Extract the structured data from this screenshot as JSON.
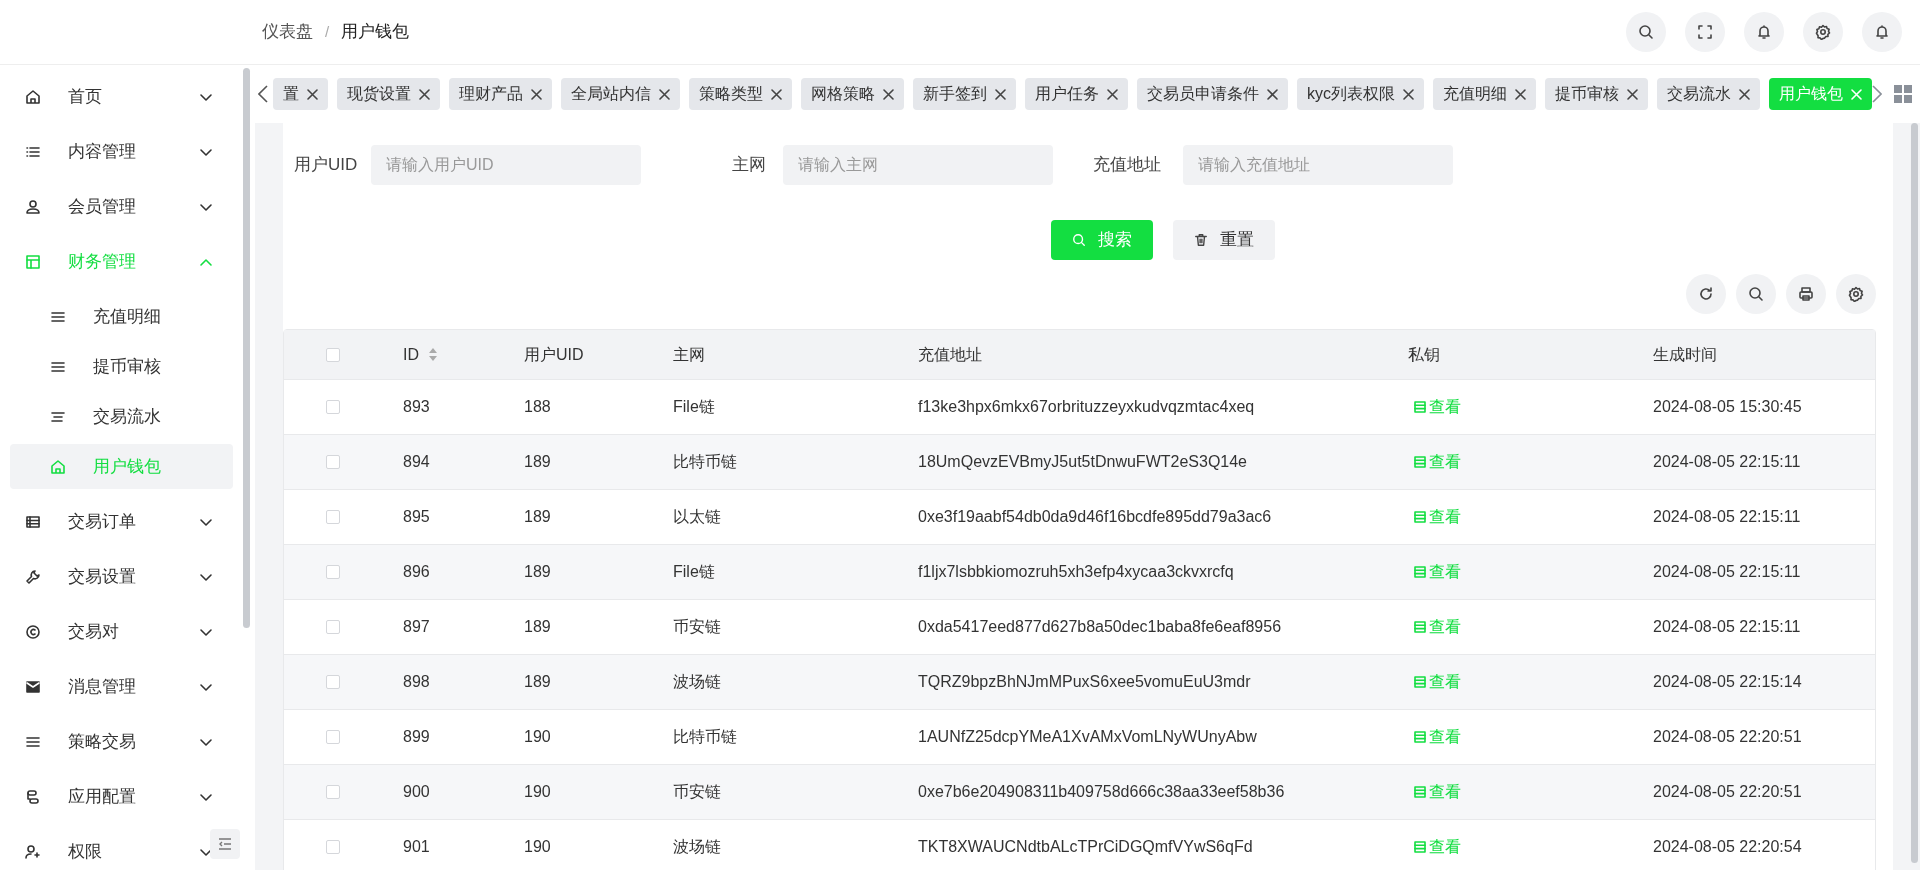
{
  "breadcrumb": [
    "仪表盘",
    "用户钱包"
  ],
  "breadcrumb_separator": "/",
  "sidebar": {
    "items": [
      {
        "label": "首页",
        "expanded": false
      },
      {
        "label": "内容管理",
        "expanded": false
      },
      {
        "label": "会员管理",
        "expanded": false
      },
      {
        "label": "财务管理",
        "expanded": true,
        "children": [
          {
            "label": "充值明细",
            "selected": false
          },
          {
            "label": "提币审核",
            "selected": false
          },
          {
            "label": "交易流水",
            "selected": false
          },
          {
            "label": "用户钱包",
            "selected": true
          }
        ]
      },
      {
        "label": "交易订单",
        "expanded": false
      },
      {
        "label": "交易设置",
        "expanded": false
      },
      {
        "label": "交易对",
        "expanded": false
      },
      {
        "label": "消息管理",
        "expanded": false
      },
      {
        "label": "策略交易",
        "expanded": false
      },
      {
        "label": "应用配置",
        "expanded": false
      },
      {
        "label": "权限",
        "expanded": false
      }
    ]
  },
  "tabs": [
    {
      "label": "置",
      "selected": false
    },
    {
      "label": "现货设置",
      "selected": false
    },
    {
      "label": "理财产品",
      "selected": false
    },
    {
      "label": "全局站内信",
      "selected": false
    },
    {
      "label": "策略类型",
      "selected": false
    },
    {
      "label": "网格策略",
      "selected": false
    },
    {
      "label": "新手签到",
      "selected": false
    },
    {
      "label": "用户任务",
      "selected": false
    },
    {
      "label": "交易员申请条件",
      "selected": false
    },
    {
      "label": "kyc列表权限",
      "selected": false
    },
    {
      "label": "充值明细",
      "selected": false
    },
    {
      "label": "提币审核",
      "selected": false
    },
    {
      "label": "交易流水",
      "selected": false
    },
    {
      "label": "用户钱包",
      "selected": true
    }
  ],
  "filters": [
    {
      "label": "用户UID",
      "placeholder": "请输入用户UID"
    },
    {
      "label": "主网",
      "placeholder": "请输入主网"
    },
    {
      "label": "充值地址",
      "placeholder": "请输入充值地址"
    }
  ],
  "buttons": {
    "search": "搜索",
    "reset": "重置"
  },
  "table": {
    "select_all": {
      "checked": false
    },
    "columns": [
      "ID",
      "用户UID",
      "主网",
      "充值地址",
      "私钥",
      "生成时间"
    ],
    "rows": [
      {
        "checked": false,
        "id": "893",
        "uid": "188",
        "chain": "File链",
        "address": "f13ke3hpx6mkx67orbrituzzeyxkudvqzmtac4xeq",
        "key": "查看",
        "time": "2024-08-05 15:30:45"
      },
      {
        "checked": false,
        "id": "894",
        "uid": "189",
        "chain": "比特币链",
        "address": "18UmQevzEVBmyJ5ut5tDnwuFWT2eS3Q14e",
        "key": "查看",
        "time": "2024-08-05 22:15:11"
      },
      {
        "checked": false,
        "id": "895",
        "uid": "189",
        "chain": "以太链",
        "address": "0xe3f19aabf54db0da9d46f16bcdfe895dd79a3ac6",
        "key": "查看",
        "time": "2024-08-05 22:15:11"
      },
      {
        "checked": false,
        "id": "896",
        "uid": "189",
        "chain": "File链",
        "address": "f1ljx7lsbbkiomozruh5xh3efp4xycaa3ckvxrcfq",
        "key": "查看",
        "time": "2024-08-05 22:15:11"
      },
      {
        "checked": false,
        "id": "897",
        "uid": "189",
        "chain": "币安链",
        "address": "0xda5417eed877d627b8a50dec1baba8fe6eaf8956",
        "key": "查看",
        "time": "2024-08-05 22:15:11"
      },
      {
        "checked": false,
        "id": "898",
        "uid": "189",
        "chain": "波场链",
        "address": "TQRZ9bpzBhNJmMPuxS6xee5vomuEuU3mdr",
        "key": "查看",
        "time": "2024-08-05 22:15:14"
      },
      {
        "checked": false,
        "id": "899",
        "uid": "190",
        "chain": "比特币链",
        "address": "1AUNfZ25dcpYMeA1XvAMxVomLNyWUnyAbw",
        "key": "查看",
        "time": "2024-08-05 22:20:51"
      },
      {
        "checked": false,
        "id": "900",
        "uid": "190",
        "chain": "币安链",
        "address": "0xe7b6e204908311b409758d666c38aa33eef58b36",
        "key": "查看",
        "time": "2024-08-05 22:20:51"
      },
      {
        "checked": false,
        "id": "901",
        "uid": "190",
        "chain": "波场链",
        "address": "TKT8XWAUCNdtbALcTPrCiDGQmfVYwS6qFd",
        "key": "查看",
        "time": "2024-08-05 22:20:54"
      }
    ]
  }
}
